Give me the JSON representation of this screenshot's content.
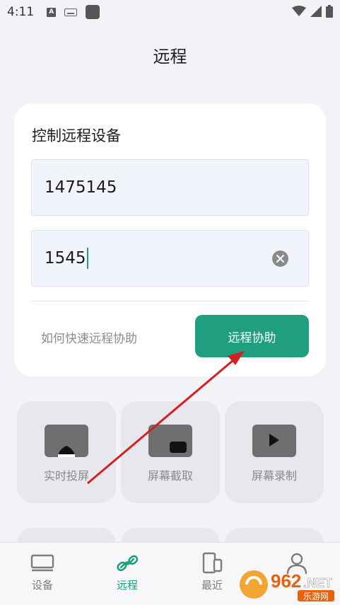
{
  "status_bar": {
    "time": "4:11",
    "left_icons": [
      "a-notification-icon",
      "keyboard-icon",
      "app-square-icon"
    ],
    "right_icons": [
      "wifi-icon",
      "signal-icon",
      "battery-icon"
    ]
  },
  "header": {
    "title": "远程"
  },
  "card": {
    "title": "控制远程设备",
    "device_id": {
      "value": "1475145"
    },
    "password": {
      "value": "1545"
    },
    "help_link": "如何快速远程协助",
    "primary_button": "远程协助"
  },
  "features": [
    {
      "label": "实时投屏",
      "icon": "screen-cast-icon"
    },
    {
      "label": "屏幕截取",
      "icon": "screen-capture-icon"
    },
    {
      "label": "屏幕录制",
      "icon": "screen-record-icon"
    }
  ],
  "bottom_nav": [
    {
      "label": "设备",
      "icon": "devices-icon",
      "active": false
    },
    {
      "label": "远程",
      "icon": "link-icon",
      "active": true
    },
    {
      "label": "最近",
      "icon": "recent-icon",
      "active": false
    },
    {
      "label": "",
      "icon": "profile-icon",
      "active": false
    }
  ],
  "watermark": {
    "brand": "962",
    "suffix": ".NET",
    "sub": "乐游网"
  },
  "colors": {
    "accent": "#1f9f80",
    "background": "#f2f3f6",
    "card": "#ffffff",
    "annotation_arrow": "#d42020"
  }
}
